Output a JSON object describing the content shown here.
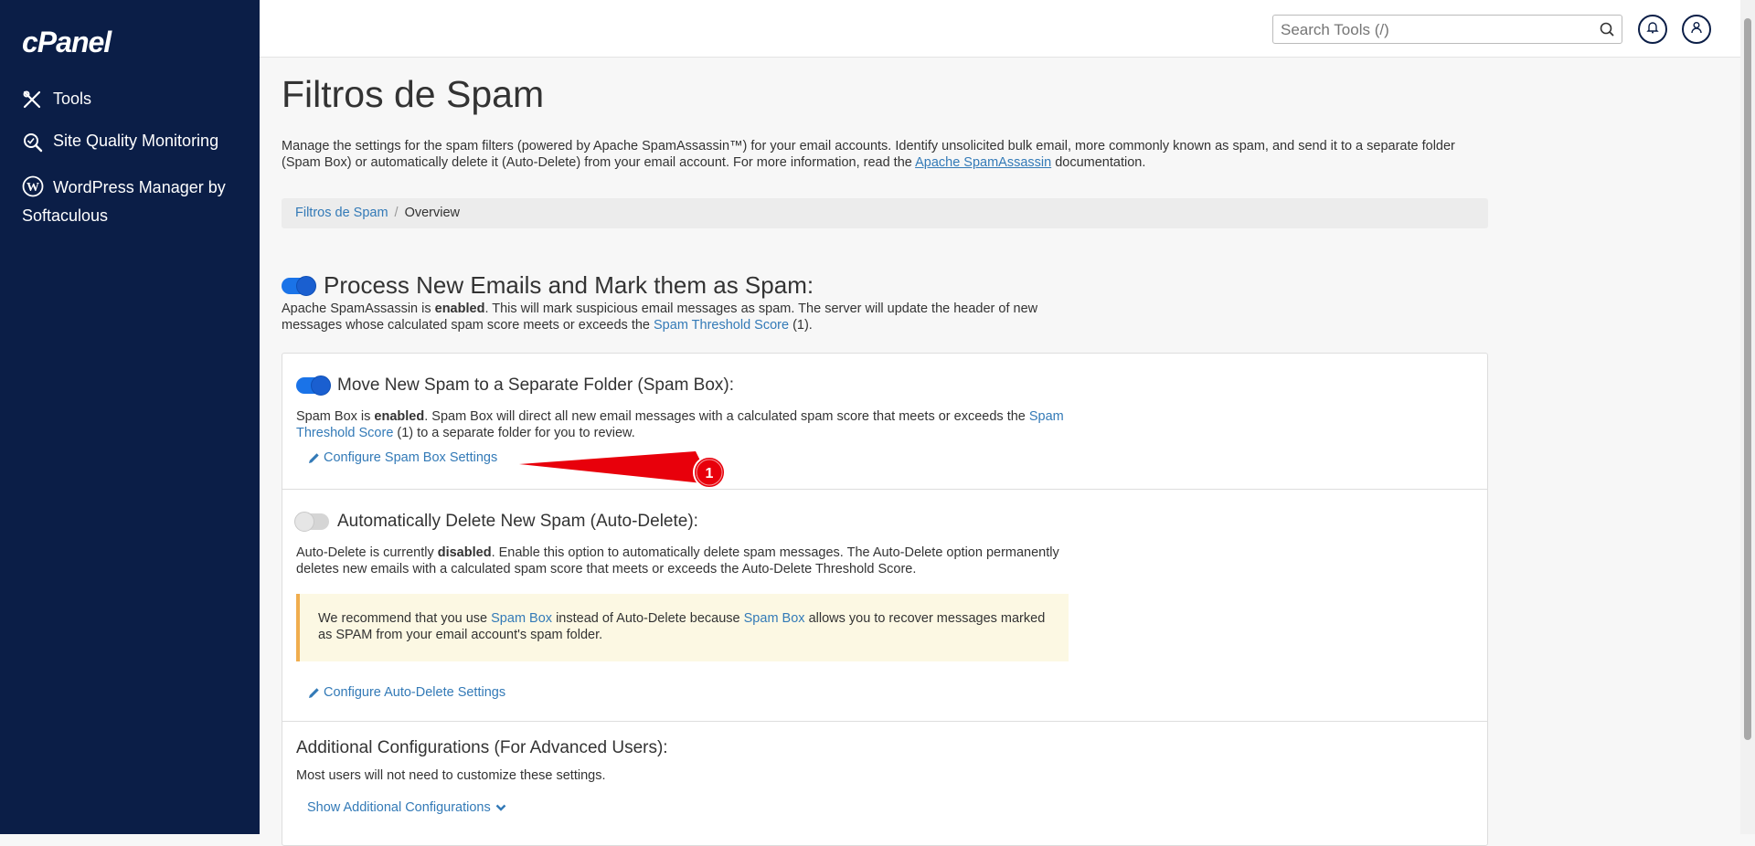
{
  "sidebar": {
    "logo": "cPanel",
    "items": [
      {
        "label": "Tools"
      },
      {
        "label": "Site Quality Monitoring"
      },
      {
        "label": "WordPress Manager by Softaculous"
      }
    ]
  },
  "header": {
    "search_placeholder": "Search Tools (/)"
  },
  "page": {
    "title": "Filtros de Spam",
    "description_prefix": "Manage the settings for the spam filters (powered by Apache SpamAssassin™) for your email accounts. Identify unsolicited bulk email, more commonly known as spam, and send it to a separate folder (Spam Box) or automatically delete it (Auto-Delete) from your email account. For more information, read the ",
    "description_link": "Apache SpamAssassin",
    "description_suffix": " documentation."
  },
  "breadcrumb": {
    "root": "Filtros de Spam",
    "current": "Overview"
  },
  "process_section": {
    "enabled": true,
    "title": "Process New Emails and Mark them as Spam:",
    "desc_prefix": "Apache SpamAssassin is ",
    "desc_bold": "enabled",
    "desc_middle": ". This will mark suspicious email messages as spam. The server will update the header of new messages whose calculated spam score meets or exceeds the ",
    "desc_link": "Spam Threshold Score",
    "desc_suffix": " (1)."
  },
  "spam_box": {
    "enabled": true,
    "title": "Move New Spam to a Separate Folder (Spam Box):",
    "desc_prefix": "Spam Box is ",
    "desc_bold": "enabled",
    "desc_middle": ". Spam Box will direct all new email messages with a calculated spam score that meets or exceeds the ",
    "desc_link": "Spam Threshold Score",
    "desc_suffix": " (1) to a separate folder for you to review.",
    "configure_label": "Configure Spam Box Settings"
  },
  "auto_delete": {
    "enabled": false,
    "title": "Automatically Delete New Spam (Auto-Delete):",
    "desc_prefix": "Auto-Delete is currently ",
    "desc_bold": "disabled",
    "desc_suffix": ". Enable this option to automatically delete spam messages. The Auto-Delete option permanently deletes new emails with a calculated spam score that meets or exceeds the Auto-Delete Threshold Score.",
    "warning_prefix": "We recommend that you use ",
    "warning_link1": "Spam Box",
    "warning_middle": " instead of Auto-Delete because ",
    "warning_link2": "Spam Box",
    "warning_suffix": " allows you to recover messages marked as SPAM from your email account's spam folder.",
    "configure_label": "Configure Auto-Delete Settings"
  },
  "additional": {
    "title": "Additional Configurations (For Advanced Users):",
    "desc": "Most users will not need to customize these settings.",
    "show_label": "Show Additional Configurations"
  },
  "annotation": {
    "number": "1",
    "color": "#e8000b"
  },
  "colors": {
    "sidebar_bg": "#0b1e47",
    "link": "#337ab7",
    "toggle_on": "#1a73e8",
    "warning_border": "#f0ad4e"
  }
}
